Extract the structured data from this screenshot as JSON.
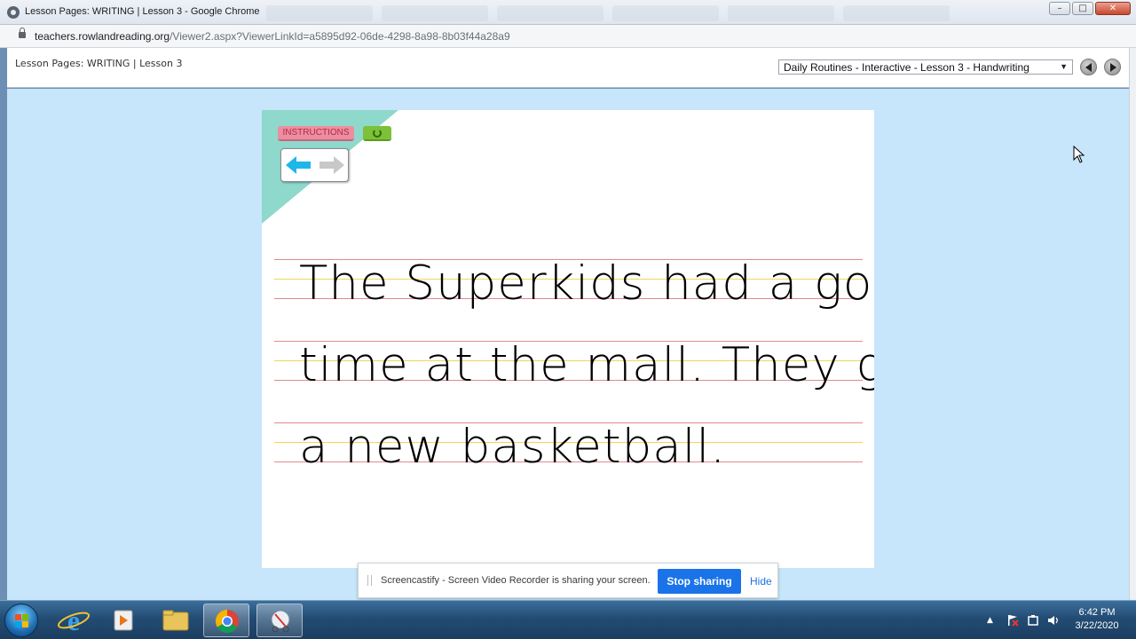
{
  "window": {
    "title": "Lesson Pages: WRITING | Lesson 3 - Google Chrome"
  },
  "address": {
    "host": "teachers.rowlandreading.org",
    "path": "/Viewer2.aspx?ViewerLinkId=a5895d92-06de-4298-8a98-8b03f44a28a9"
  },
  "viewer": {
    "lesson_label": "Lesson Pages: WRITING | Lesson 3",
    "selected_lesson": "Daily Routines - Interactive - Lesson 3 - Handwriting"
  },
  "activity": {
    "instructions_label": "INSTRUCTIONS",
    "lines": [
      "The Superkids had a good",
      "time at the mall. They got",
      "a new basketball."
    ],
    "colors": {
      "corner": "#8fd8cc",
      "instructions_bg": "#ec8ea0",
      "reset_bg": "#7dc13a",
      "back_arrow": "#1fb6e8",
      "forward_arrow": "#c8c8c8",
      "guide_red": "#e08a8f",
      "guide_yellow": "#f4d35a"
    }
  },
  "screencastify": {
    "message": "Screencastify - Screen Video Recorder is sharing your screen.",
    "stop_label": "Stop sharing",
    "hide_label": "Hide"
  },
  "taskbar": {
    "time": "6:42 PM",
    "date": "3/22/2020"
  }
}
